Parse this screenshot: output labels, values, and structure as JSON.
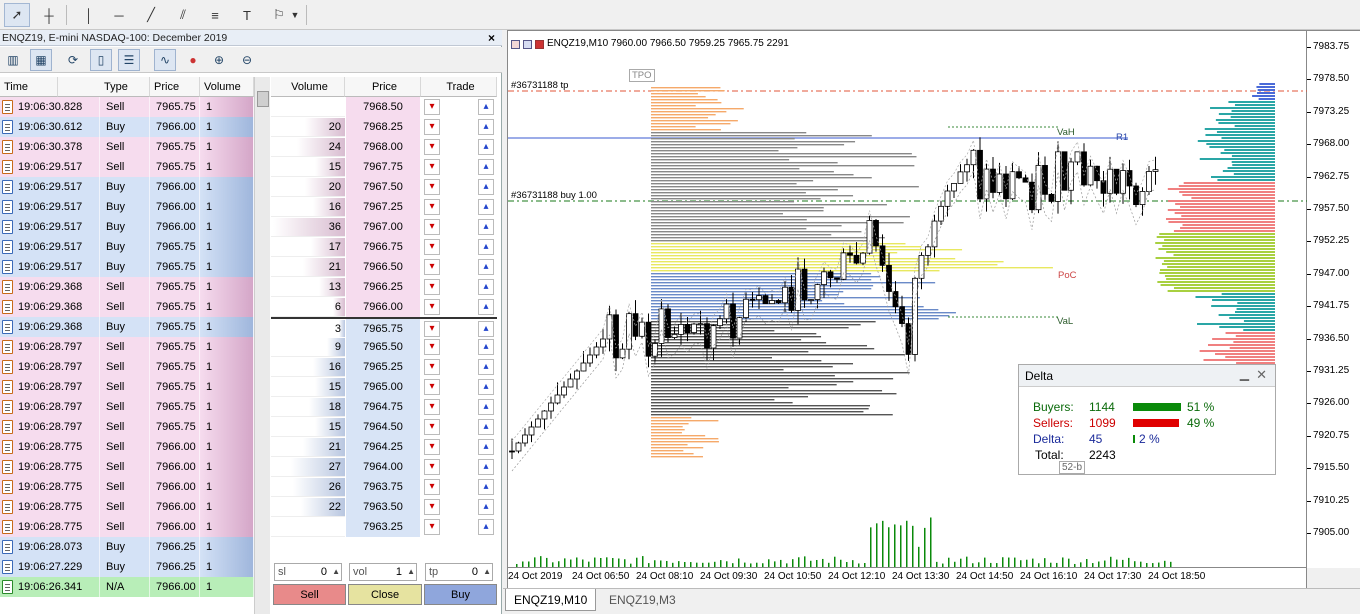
{
  "panel": {
    "title": "ENQZ19, E-mini NASDAQ-100: December 2019",
    "close": "×"
  },
  "trades": {
    "headers": [
      "Time",
      "Type",
      "Price",
      "Volume"
    ],
    "rows": [
      {
        "time": "19:06:30.828",
        "type": "Sell",
        "price": "7965.75",
        "volume": "1"
      },
      {
        "time": "19:06:30.612",
        "type": "Buy",
        "price": "7966.00",
        "volume": "1"
      },
      {
        "time": "19:06:30.378",
        "type": "Sell",
        "price": "7965.75",
        "volume": "1"
      },
      {
        "time": "19:06:29.517",
        "type": "Sell",
        "price": "7965.75",
        "volume": "1"
      },
      {
        "time": "19:06:29.517",
        "type": "Buy",
        "price": "7966.00",
        "volume": "1"
      },
      {
        "time": "19:06:29.517",
        "type": "Buy",
        "price": "7966.00",
        "volume": "1"
      },
      {
        "time": "19:06:29.517",
        "type": "Buy",
        "price": "7966.00",
        "volume": "1"
      },
      {
        "time": "19:06:29.517",
        "type": "Buy",
        "price": "7965.75",
        "volume": "1"
      },
      {
        "time": "19:06:29.517",
        "type": "Buy",
        "price": "7965.75",
        "volume": "1"
      },
      {
        "time": "19:06:29.368",
        "type": "Sell",
        "price": "7965.75",
        "volume": "1"
      },
      {
        "time": "19:06:29.368",
        "type": "Sell",
        "price": "7965.75",
        "volume": "1"
      },
      {
        "time": "19:06:29.368",
        "type": "Buy",
        "price": "7965.75",
        "volume": "1"
      },
      {
        "time": "19:06:28.797",
        "type": "Sell",
        "price": "7965.75",
        "volume": "1"
      },
      {
        "time": "19:06:28.797",
        "type": "Sell",
        "price": "7965.75",
        "volume": "1"
      },
      {
        "time": "19:06:28.797",
        "type": "Sell",
        "price": "7965.75",
        "volume": "1"
      },
      {
        "time": "19:06:28.797",
        "type": "Sell",
        "price": "7965.75",
        "volume": "1"
      },
      {
        "time": "19:06:28.797",
        "type": "Sell",
        "price": "7965.75",
        "volume": "1"
      },
      {
        "time": "19:06:28.775",
        "type": "Sell",
        "price": "7966.00",
        "volume": "1"
      },
      {
        "time": "19:06:28.775",
        "type": "Sell",
        "price": "7966.00",
        "volume": "1"
      },
      {
        "time": "19:06:28.775",
        "type": "Sell",
        "price": "7966.00",
        "volume": "1"
      },
      {
        "time": "19:06:28.775",
        "type": "Sell",
        "price": "7966.00",
        "volume": "1"
      },
      {
        "time": "19:06:28.775",
        "type": "Sell",
        "price": "7966.00",
        "volume": "1"
      },
      {
        "time": "19:06:28.073",
        "type": "Buy",
        "price": "7966.25",
        "volume": "1"
      },
      {
        "time": "19:06:27.229",
        "type": "Buy",
        "price": "7966.25",
        "volume": "1"
      },
      {
        "time": "19:06:26.341",
        "type": "N/A",
        "price": "7966.00",
        "volume": "1"
      }
    ]
  },
  "dom": {
    "headers": [
      "Volume",
      "Price",
      "Trade"
    ],
    "rows": [
      {
        "volume": "",
        "price": "7968.50",
        "side": "ask",
        "share": 0
      },
      {
        "volume": "20",
        "price": "7968.25",
        "side": "ask",
        "share": 0.56
      },
      {
        "volume": "24",
        "price": "7968.00",
        "side": "ask",
        "share": 0.67
      },
      {
        "volume": "15",
        "price": "7967.75",
        "side": "ask",
        "share": 0.42
      },
      {
        "volume": "20",
        "price": "7967.50",
        "side": "ask",
        "share": 0.56
      },
      {
        "volume": "16",
        "price": "7967.25",
        "side": "ask",
        "share": 0.44
      },
      {
        "volume": "36",
        "price": "7967.00",
        "side": "ask",
        "share": 1.0
      },
      {
        "volume": "17",
        "price": "7966.75",
        "side": "ask",
        "share": 0.47
      },
      {
        "volume": "21",
        "price": "7966.50",
        "side": "ask",
        "share": 0.58
      },
      {
        "volume": "13",
        "price": "7966.25",
        "side": "ask",
        "share": 0.36
      },
      {
        "volume": "6",
        "price": "7966.00",
        "side": "ask",
        "share": 0.17
      },
      {
        "volume": "3",
        "price": "7965.75",
        "side": "bid",
        "share": 0.08
      },
      {
        "volume": "9",
        "price": "7965.50",
        "side": "bid",
        "share": 0.25
      },
      {
        "volume": "16",
        "price": "7965.25",
        "side": "bid",
        "share": 0.44
      },
      {
        "volume": "15",
        "price": "7965.00",
        "side": "bid",
        "share": 0.42
      },
      {
        "volume": "18",
        "price": "7964.75",
        "side": "bid",
        "share": 0.5
      },
      {
        "volume": "15",
        "price": "7964.50",
        "side": "bid",
        "share": 0.42
      },
      {
        "volume": "21",
        "price": "7964.25",
        "side": "bid",
        "share": 0.58
      },
      {
        "volume": "27",
        "price": "7964.00",
        "side": "bid",
        "share": 0.75
      },
      {
        "volume": "26",
        "price": "7963.75",
        "side": "bid",
        "share": 0.72
      },
      {
        "volume": "22",
        "price": "7963.50",
        "side": "bid",
        "share": 0.61
      },
      {
        "volume": "",
        "price": "7963.25",
        "side": "bid",
        "share": 0
      }
    ],
    "sl_label": "sl",
    "sl_value": "0",
    "vol_label": "vol",
    "vol_value": "1",
    "tp_label": "tp",
    "tp_value": "0",
    "sell": "Sell",
    "close": "Close",
    "buy": "Buy"
  },
  "chart": {
    "header": "ENQZ19,M10  7960.00 7966.50 7959.25 7965.75  2291",
    "tpo": "TPO",
    "tp_label": "#36731188 tp",
    "buy_label": "#36731188 buy 1.00",
    "vah": "VaH",
    "r1": "R1",
    "poc": "PoC",
    "val": "VaL",
    "y_ticks": [
      "7983.75",
      "7978.50",
      "7973.25",
      "7968.00",
      "7962.75",
      "7957.50",
      "7952.25",
      "7947.00",
      "7941.75",
      "7936.50",
      "7931.25",
      "7926.00",
      "7920.75",
      "7915.50",
      "7910.25",
      "7905.00"
    ],
    "x_ticks": [
      "24 Oct 2019",
      "24 Oct 06:50",
      "24 Oct 08:10",
      "24 Oct 09:30",
      "24 Oct 10:50",
      "24 Oct 12:10",
      "24 Oct 13:30",
      "24 Oct 14:50",
      "24 Oct 16:10",
      "24 Oct 17:30",
      "24 Oct 18:50"
    ],
    "tabs": [
      "ENQZ19,M10",
      "ENQZ19,M3"
    ],
    "colors": {
      "ask": "#f4d8ec",
      "bid": "#d8e2f4",
      "up": "#1a6fd0",
      "green": "#0a8a0a",
      "red": "#e00000"
    }
  },
  "delta": {
    "title": "Delta",
    "buyers_label": "Buyers:",
    "buyers": "1144",
    "buyers_pct": "51 %",
    "sellers_label": "Sellers:",
    "sellers": "1099",
    "sellers_pct": "49 %",
    "delta_label": "Delta:",
    "delta": "45",
    "delta_pct": "2 %",
    "total_label": "Total:",
    "total": "2243",
    "tag": "52-b"
  }
}
